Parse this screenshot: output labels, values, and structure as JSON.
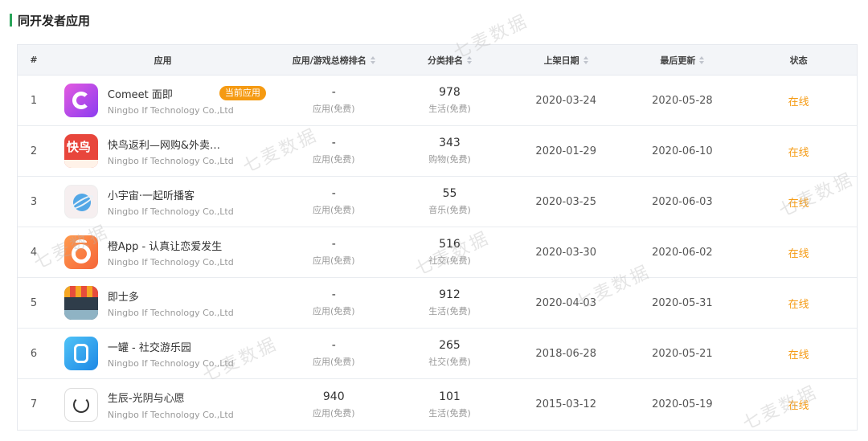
{
  "section_title": "同开发者应用",
  "columns": {
    "index": "#",
    "app": "应用",
    "total_rank": "应用/游戏总榜排名",
    "category_rank": "分类排名",
    "release_date": "上架日期",
    "last_update": "最后更新",
    "status": "状态"
  },
  "current_app_badge": "当前应用",
  "rows": [
    {
      "index": "1",
      "name": "Comeet 面即",
      "developer": "Ningbo If Technology Co.,Ltd",
      "total_rank": "-",
      "total_label": "应用(免费)",
      "cat_rank": "978",
      "cat_label": "生活(免费)",
      "release": "2020-03-24",
      "update": "2020-05-28",
      "status": "在线",
      "icon": "comeet-app-icon"
    },
    {
      "index": "2",
      "name": "快鸟返利—网购&外卖…",
      "developer": "Ningbo If Technology Co.,Ltd",
      "total_rank": "-",
      "total_label": "应用(免费)",
      "cat_rank": "343",
      "cat_label": "购物(免费)",
      "release": "2020-01-29",
      "update": "2020-06-10",
      "status": "在线",
      "icon": "kuainiao-app-icon",
      "icon_text": "快鸟"
    },
    {
      "index": "3",
      "name": "小宇宙·一起听播客",
      "developer": "Ningbo If Technology Co.,Ltd",
      "total_rank": "-",
      "total_label": "应用(免费)",
      "cat_rank": "55",
      "cat_label": "音乐(免费)",
      "release": "2020-03-25",
      "update": "2020-06-03",
      "status": "在线",
      "icon": "planet-app-icon"
    },
    {
      "index": "4",
      "name": "橙App - 认真让恋爱发生",
      "developer": "Ningbo If Technology Co.,Ltd",
      "total_rank": "-",
      "total_label": "应用(免费)",
      "cat_rank": "516",
      "cat_label": "社交(免费)",
      "release": "2020-03-30",
      "update": "2020-06-02",
      "status": "在线",
      "icon": "orange-app-icon"
    },
    {
      "index": "5",
      "name": "即士多",
      "developer": "Ningbo If Technology Co.,Ltd",
      "total_rank": "-",
      "total_label": "应用(免费)",
      "cat_rank": "912",
      "cat_label": "生活(免费)",
      "release": "2020-04-03",
      "update": "2020-05-31",
      "status": "在线",
      "icon": "store-app-icon"
    },
    {
      "index": "6",
      "name": "一罐 - 社交游乐园",
      "developer": "Ningbo If Technology Co.,Ltd",
      "total_rank": "-",
      "total_label": "应用(免费)",
      "cat_rank": "265",
      "cat_label": "社交(免费)",
      "release": "2018-06-28",
      "update": "2020-05-21",
      "status": "在线",
      "icon": "jar-app-icon"
    },
    {
      "index": "7",
      "name": "生辰-光阴与心愿",
      "developer": "Ningbo If Technology Co.,Ltd",
      "total_rank": "940",
      "total_label": "应用(免费)",
      "cat_rank": "101",
      "cat_label": "生活(免费)",
      "release": "2015-03-12",
      "update": "2020-05-19",
      "status": "在线",
      "icon": "circle-app-icon"
    }
  ],
  "watermark": "七麦数据",
  "colors": {
    "accent": "#2aa55a",
    "status": "#f59a12",
    "header_bg": "#f3f5f8"
  }
}
